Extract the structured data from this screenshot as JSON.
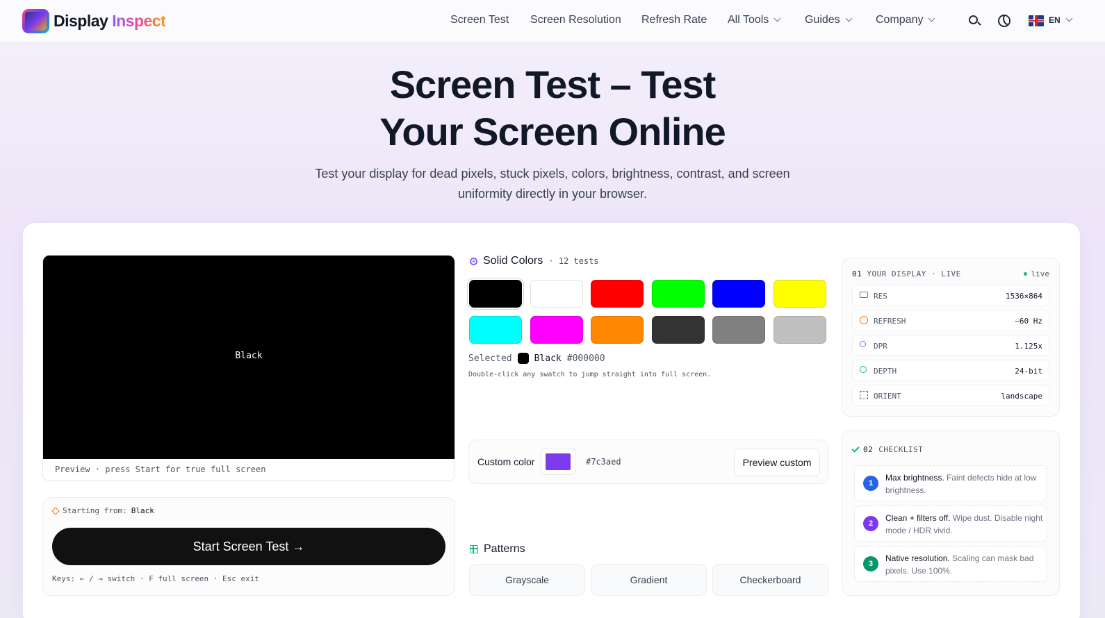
{
  "nav": {
    "brand_part1": "Display",
    "brand_part2": "Inspect",
    "links": [
      "Screen Test",
      "Screen Resolution",
      "Refresh Rate",
      "All Tools",
      "Guides",
      "Company"
    ],
    "lang": "EN"
  },
  "hero": {
    "title_line1": "Screen Test – Test",
    "title_line2": "Your Screen Online",
    "subtitle_line1": "Test your display for dead pixels, stuck pixels, colors, brightness, contrast, and screen",
    "subtitle_line2": "uniformity directly in your browser."
  },
  "preview": {
    "color_name": "Black",
    "caption": "Preview · press Start for true full screen"
  },
  "start": {
    "from_label": "Starting from:",
    "from_value": "Black",
    "button": "Start Screen Test →",
    "keys": "Keys: ← / → switch · F full screen · Esc exit"
  },
  "colors": {
    "title": "Solid Colors",
    "count": "· 12 tests",
    "swatches": [
      {
        "name": "black",
        "hex": "#000000"
      },
      {
        "name": "white",
        "hex": "#ffffff"
      },
      {
        "name": "red",
        "hex": "#ff0000"
      },
      {
        "name": "green",
        "hex": "#00ff00"
      },
      {
        "name": "blue",
        "hex": "#0000ff"
      },
      {
        "name": "yellow",
        "hex": "#ffff00"
      },
      {
        "name": "cyan",
        "hex": "#00ffff"
      },
      {
        "name": "magenta",
        "hex": "#ff00ff"
      },
      {
        "name": "orange",
        "hex": "#ff8800"
      },
      {
        "name": "dark-gray",
        "hex": "#333333"
      },
      {
        "name": "gray",
        "hex": "#808080"
      },
      {
        "name": "light-gray",
        "hex": "#c0c0c0"
      }
    ],
    "selected_label": "Selected",
    "selected_name": "Black",
    "selected_hex": "#000000",
    "hint": "Double-click any swatch to jump straight into full screen."
  },
  "custom": {
    "label": "Custom color",
    "hex": "#7c3aed",
    "button": "Preview custom"
  },
  "patterns": {
    "title": "Patterns",
    "items": [
      "Grayscale",
      "Gradient",
      "Checkerboard"
    ]
  },
  "display": {
    "num": "01",
    "title": "YOUR DISPLAY · LIVE",
    "live": "live",
    "rows": [
      {
        "k": "RES",
        "v": "1536×864"
      },
      {
        "k": "REFRESH",
        "v": "~60 Hz"
      },
      {
        "k": "DPR",
        "v": "1.125x"
      },
      {
        "k": "DEPTH",
        "v": "24-bit"
      },
      {
        "k": "ORIENT",
        "v": "landscape"
      }
    ]
  },
  "checklist": {
    "num": "02",
    "title": "CHECKLIST",
    "items": [
      {
        "n": "1",
        "bold": "Max brightness.",
        "text": " Faint defects hide at low brightness.",
        "color": "#2563eb"
      },
      {
        "n": "2",
        "bold": "Clean + filters off.",
        "text": " Wipe dust. Disable night mode / HDR vivid.",
        "color": "#7c3aed"
      },
      {
        "n": "3",
        "bold": "Native resolution.",
        "text": " Scaling can mask bad pixels. Use 100%.",
        "color": "#059669"
      }
    ]
  }
}
